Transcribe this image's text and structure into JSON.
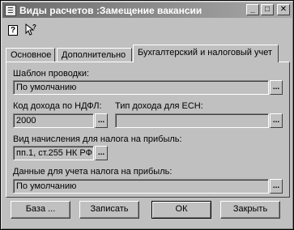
{
  "window": {
    "title": "Виды расчетов :Замещение вакансии"
  },
  "title_buttons": {
    "minimize": "_",
    "maximize": "□",
    "close": "✕"
  },
  "toolbar": {
    "help_icon": "help-icon",
    "help_glyph": "?",
    "context_help_icon": "context-help-icon"
  },
  "tabs": [
    {
      "label": "Основное"
    },
    {
      "label": "Дополнительно"
    },
    {
      "label": "Бухгалтерский и налоговый учет"
    }
  ],
  "form": {
    "template_label": "Шаблон проводки:",
    "template_value": "По умолчанию",
    "ndfl_label": "Код дохода по НДФЛ:",
    "ndfl_value": "2000",
    "esn_label": "Тип дохода для ЕСН:",
    "esn_value": "",
    "profit_type_label": "Вид начисления для налога на прибыль:",
    "profit_type_value": "пп.1, ст.255 НК РФ",
    "profit_data_label": "Данные для учета налога на прибыль:",
    "profit_data_value": "По умолчанию",
    "select_glyph": "..."
  },
  "buttons": {
    "base": "База ...",
    "save": "Записать",
    "ok": "ОК",
    "close": "Закрыть"
  }
}
